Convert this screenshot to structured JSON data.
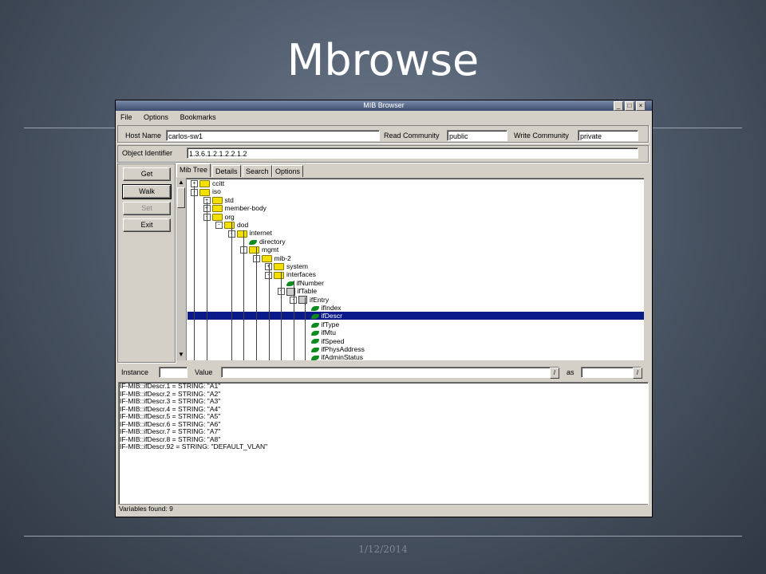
{
  "slide": {
    "title": "Mbrowse",
    "date": "1/12/2014"
  },
  "window": {
    "title": "MIB Browser",
    "menu": [
      "File",
      "Options",
      "Bookmarks"
    ],
    "host_label": "Host Name",
    "host_value": "carlos-sw1",
    "read_label": "Read Community",
    "read_value": "public",
    "write_label": "Write Community",
    "write_value": "private",
    "oid_label": "Object Identifier",
    "oid_value": "1.3.6.1.2.1.2.2.1.2",
    "buttons": [
      "Get",
      "Walk",
      "Set",
      "Exit"
    ],
    "tabs": [
      "Mib Tree",
      "Details",
      "Search",
      "Options"
    ],
    "instance_label": "Instance",
    "value_label": "Value",
    "as_label": "as",
    "tree": [
      {
        "label": "ccitt",
        "icon": "folder-icon"
      },
      {
        "label": "iso",
        "icon": "folder-icon"
      },
      {
        "label": "std",
        "icon": "folder-icon"
      },
      {
        "label": "member-body",
        "icon": "folder-icon"
      },
      {
        "label": "org",
        "icon": "folder-icon"
      },
      {
        "label": "dod",
        "icon": "folder-icon"
      },
      {
        "label": "internet",
        "icon": "folder-icon"
      },
      {
        "label": "directory",
        "icon": "leaf-icon"
      },
      {
        "label": "mgmt",
        "icon": "folder-icon"
      },
      {
        "label": "mib-2",
        "icon": "folder-icon"
      },
      {
        "label": "system",
        "icon": "folder-icon"
      },
      {
        "label": "interfaces",
        "icon": "folder-icon"
      },
      {
        "label": "ifNumber",
        "icon": "leaf-icon"
      },
      {
        "label": "ifTable",
        "icon": "table-icon"
      },
      {
        "label": "ifEntry",
        "icon": "table-icon"
      },
      {
        "label": "ifIndex",
        "icon": "leaf-icon"
      },
      {
        "label": "ifDescr",
        "icon": "leaf-icon"
      },
      {
        "label": "ifType",
        "icon": "leaf-icon"
      },
      {
        "label": "ifMtu",
        "icon": "leaf-icon"
      },
      {
        "label": "ifSpeed",
        "icon": "leaf-icon"
      },
      {
        "label": "ifPhysAddress",
        "icon": "leaf-icon"
      },
      {
        "label": "ifAdminStatus",
        "icon": "leaf-icon"
      }
    ],
    "output": [
      "IF-MIB::ifDescr.1 = STRING: \"A1\"",
      "IF-MIB::ifDescr.2 = STRING: \"A2\"",
      "IF-MIB::ifDescr.3 = STRING: \"A3\"",
      "IF-MIB::ifDescr.4 = STRING: \"A4\"",
      "IF-MIB::ifDescr.5 = STRING: \"A5\"",
      "IF-MIB::ifDescr.6 = STRING: \"A6\"",
      "IF-MIB::ifDescr.7 = STRING: \"A7\"",
      "IF-MIB::ifDescr.8 = STRING: \"A8\"",
      "IF-MIB::ifDescr.92 = STRING: \"DEFAULT_VLAN\""
    ],
    "status": "Variables found: 9"
  }
}
